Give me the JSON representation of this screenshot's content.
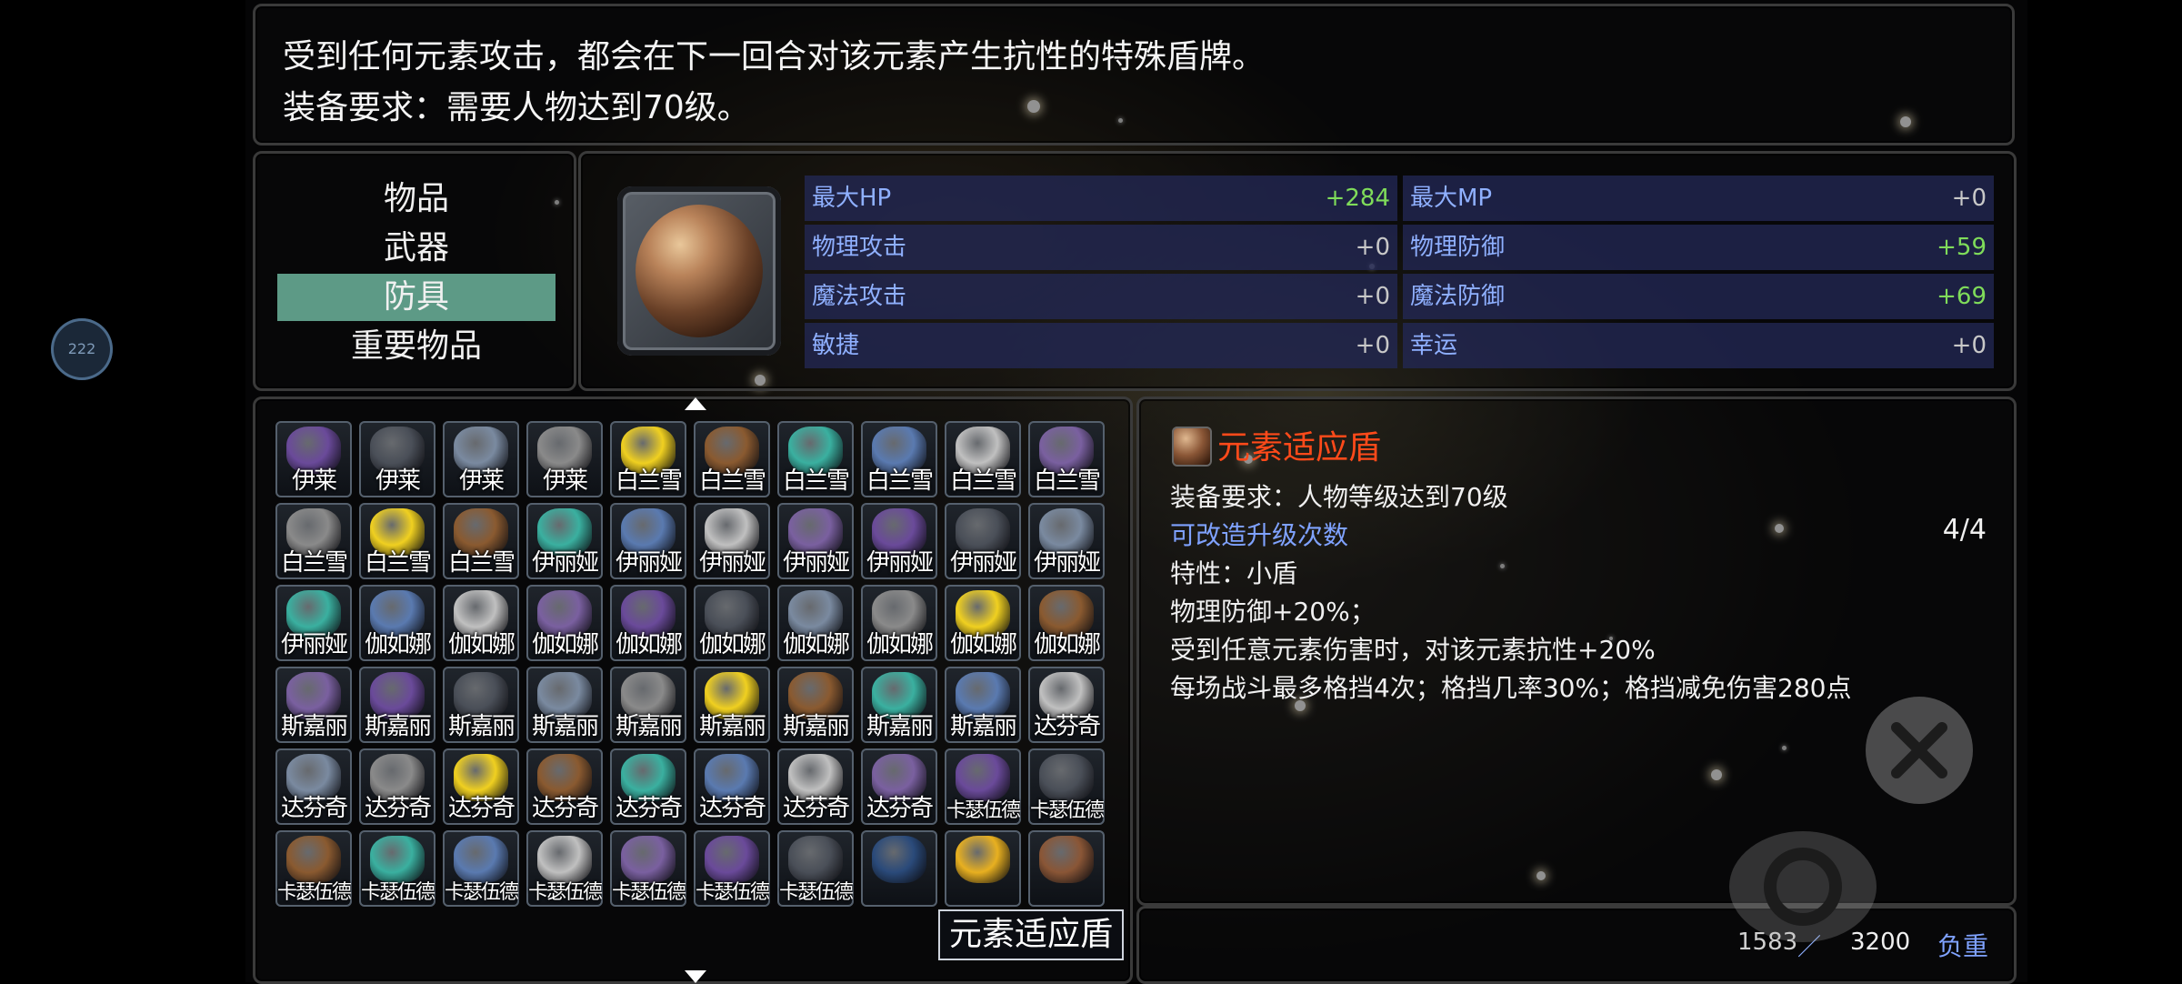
{
  "description": {
    "line1": "受到任何元素攻击，都会在下一回合对该元素产生抗性的特殊盾牌。",
    "line2": "装备要求：需要人物达到70级。"
  },
  "categories": [
    {
      "label": "物品",
      "selected": false
    },
    {
      "label": "武器",
      "selected": false
    },
    {
      "label": "防具",
      "selected": true
    },
    {
      "label": "重要物品",
      "selected": false
    }
  ],
  "stats": [
    {
      "label": "最大HP",
      "value": "+284",
      "positive": true
    },
    {
      "label": "最大MP",
      "value": "+0",
      "positive": false
    },
    {
      "label": "物理攻击",
      "value": "+0",
      "positive": false
    },
    {
      "label": "物理防御",
      "value": "+59",
      "positive": true
    },
    {
      "label": "魔法攻击",
      "value": "+0",
      "positive": false
    },
    {
      "label": "魔法防御",
      "value": "+69",
      "positive": true
    },
    {
      "label": "敏捷",
      "value": "+0",
      "positive": false
    },
    {
      "label": "幸运",
      "value": "+0",
      "positive": false
    }
  ],
  "inventory": [
    [
      "伊莱",
      "伊莱",
      "伊莱",
      "伊莱",
      "白兰雪",
      "白兰雪",
      "白兰雪",
      "白兰雪",
      "白兰雪",
      "白兰雪"
    ],
    [
      "白兰雪",
      "白兰雪",
      "白兰雪",
      "伊丽娅",
      "伊丽娅",
      "伊丽娅",
      "伊丽娅",
      "伊丽娅",
      "伊丽娅",
      "伊丽娅"
    ],
    [
      "伊丽娅",
      "伽如娜",
      "伽如娜",
      "伽如娜",
      "伽如娜",
      "伽如娜",
      "伽如娜",
      "伽如娜",
      "伽如娜",
      "伽如娜"
    ],
    [
      "斯嘉丽",
      "斯嘉丽",
      "斯嘉丽",
      "斯嘉丽",
      "斯嘉丽",
      "斯嘉丽",
      "斯嘉丽",
      "斯嘉丽",
      "斯嘉丽",
      "达芬奇"
    ],
    [
      "达芬奇",
      "达芬奇",
      "达芬奇",
      "达芬奇",
      "达芬奇",
      "达芬奇",
      "达芬奇",
      "达芬奇",
      "卡瑟伍德",
      "卡瑟伍德"
    ],
    [
      "卡瑟伍德",
      "卡瑟伍德",
      "卡瑟伍德",
      "卡瑟伍德",
      "卡瑟伍德",
      "卡瑟伍德",
      "卡瑟伍德",
      "",
      "",
      ""
    ]
  ],
  "item_colors": [
    "#6a4a9a",
    "#4a4f58",
    "#7a8aa0",
    "#8a8a8a",
    "#f0d020",
    "#8a5a30",
    "#3ab0a0",
    "#5a7ab0",
    "#c0c0c0",
    "#7a60a0"
  ],
  "tooltip": "元素适应盾",
  "detail": {
    "name": "元素适应盾",
    "requirement": "装备要求：人物等级达到70级",
    "upgrade_label": "可改造升级次数",
    "upgrade_count": "4/4",
    "trait": "特性：小盾",
    "effect1": "物理防御+20%；",
    "effect2": "受到任意元素伤害时，对该元素抗性+20%",
    "effect3": "每场战斗最多格挡4次；格挡几率30%；格挡减免伤害280点"
  },
  "weight": {
    "current": "1583",
    "max": "3200",
    "label": "负重"
  },
  "badge": "222",
  "colors": {
    "selected_category": "#5d9a86",
    "stat_label": "#8fb0ff",
    "positive_value": "#7fdc5a",
    "item_name": "#ff4a1a"
  }
}
